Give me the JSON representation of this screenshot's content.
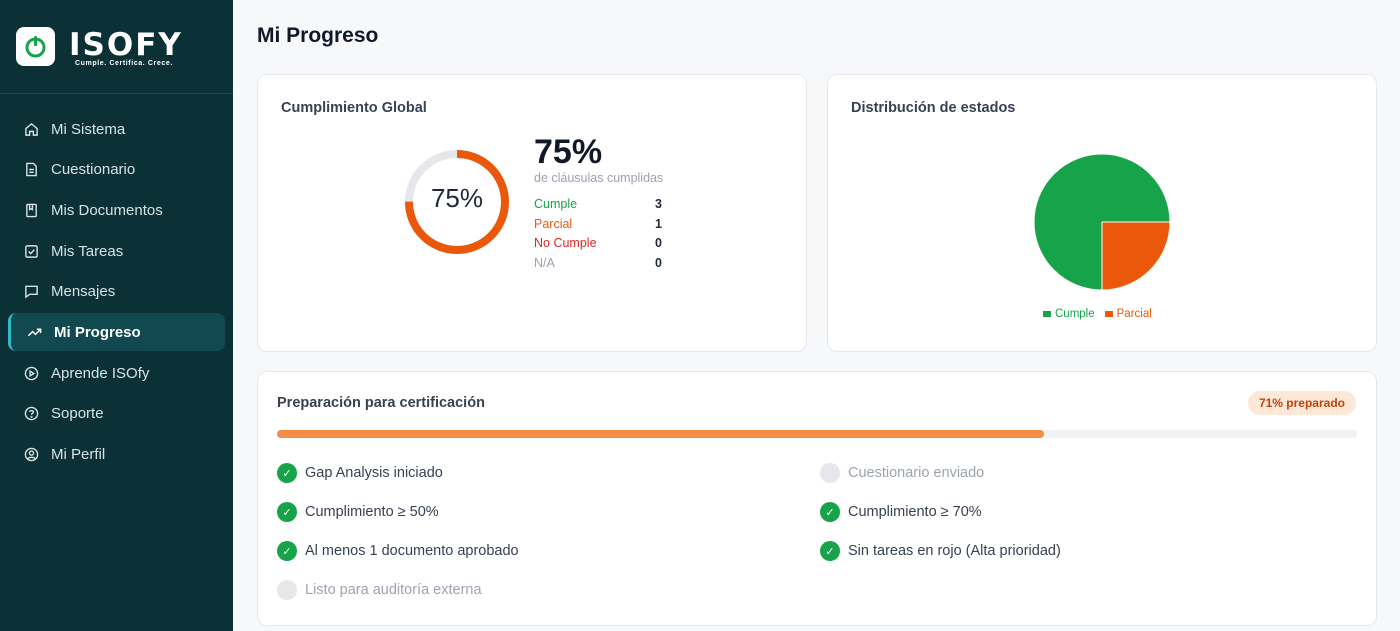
{
  "brand": {
    "name": "ISOFY",
    "tagline": "Cumple. Certifica. Crece."
  },
  "sidebar": {
    "items": [
      {
        "label": "Mi Sistema",
        "icon": "home-icon"
      },
      {
        "label": "Cuestionario",
        "icon": "document-icon"
      },
      {
        "label": "Mis Documentos",
        "icon": "book-icon"
      },
      {
        "label": "Mis Tareas",
        "icon": "checkbox-icon"
      },
      {
        "label": "Mensajes",
        "icon": "message-icon"
      },
      {
        "label": "Mi Progreso",
        "icon": "trend-icon",
        "active": true
      },
      {
        "label": "Aprende ISOfy",
        "icon": "play-icon"
      },
      {
        "label": "Soporte",
        "icon": "help-icon"
      },
      {
        "label": "Mi Perfil",
        "icon": "user-icon"
      }
    ]
  },
  "page": {
    "title": "Mi Progreso"
  },
  "global": {
    "title": "Cumplimiento Global",
    "percent": 75,
    "percent_label": "75%",
    "subtitle": "de cláusulas cumplidas",
    "stats": [
      {
        "label": "Cumple",
        "value": "3",
        "color": "#16a34a"
      },
      {
        "label": "Parcial",
        "value": "1",
        "color": "#ea580c"
      },
      {
        "label": "No Cumple",
        "value": "0",
        "color": "#dc2626"
      },
      {
        "label": "N/A",
        "value": "0",
        "color": "#9ca3af"
      }
    ]
  },
  "distribution": {
    "title": "Distribución de estados",
    "legend": [
      {
        "label": "Cumple",
        "color": "#16a34a"
      },
      {
        "label": "Parcial",
        "color": "#ea580c"
      }
    ]
  },
  "chart_data": {
    "type": "pie",
    "categories": [
      "Cumple",
      "Parcial"
    ],
    "values": [
      3,
      1
    ],
    "colors": [
      "#16a34a",
      "#ea580c"
    ],
    "legend_position": "bottom"
  },
  "certification": {
    "title": "Preparación para certificación",
    "badge": "71% preparado",
    "progress": 0.71,
    "checklist_left": [
      {
        "label": "Gap Analysis iniciado",
        "done": true
      },
      {
        "label": "Cumplimiento ≥ 50%",
        "done": true
      },
      {
        "label": "Al menos 1 documento aprobado",
        "done": true
      },
      {
        "label": "Listo para auditoría externa",
        "done": false
      }
    ],
    "checklist_right": [
      {
        "label": "Cuestionario enviado",
        "done": false
      },
      {
        "label": "Cumplimiento ≥ 70%",
        "done": true
      },
      {
        "label": "Sin tareas en rojo (Alta prioridad)",
        "done": true
      }
    ],
    "check_mark": "✓"
  }
}
